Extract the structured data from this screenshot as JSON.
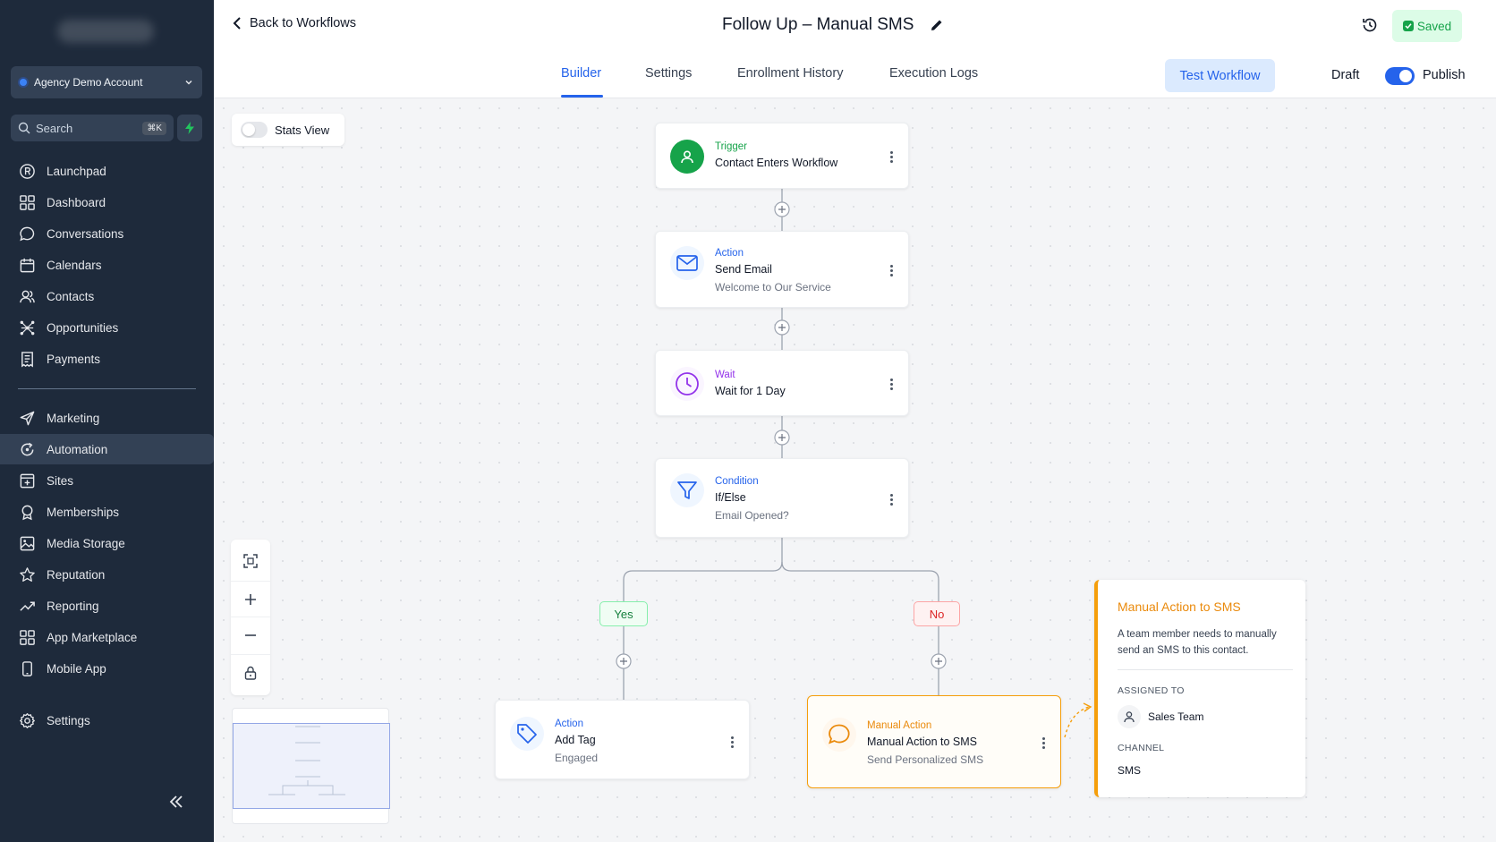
{
  "sidebar": {
    "account": "Agency Demo Account",
    "search_placeholder": "Search",
    "search_shortcut": "⌘K",
    "items": [
      {
        "label": "Launchpad",
        "icon": "launchpad-icon"
      },
      {
        "label": "Dashboard",
        "icon": "dashboard-icon"
      },
      {
        "label": "Conversations",
        "icon": "chat-icon"
      },
      {
        "label": "Calendars",
        "icon": "calendar-icon"
      },
      {
        "label": "Contacts",
        "icon": "contacts-icon"
      },
      {
        "label": "Opportunities",
        "icon": "opportunities-icon"
      },
      {
        "label": "Payments",
        "icon": "payments-icon"
      },
      {
        "label": "Marketing",
        "icon": "send-icon"
      },
      {
        "label": "Automation",
        "icon": "automation-icon"
      },
      {
        "label": "Sites",
        "icon": "sites-icon"
      },
      {
        "label": "Memberships",
        "icon": "memberships-icon"
      },
      {
        "label": "Media Storage",
        "icon": "image-icon"
      },
      {
        "label": "Reputation",
        "icon": "star-icon"
      },
      {
        "label": "Reporting",
        "icon": "trend-icon"
      },
      {
        "label": "App Marketplace",
        "icon": "grid-icon"
      },
      {
        "label": "Mobile App",
        "icon": "phone-icon"
      },
      {
        "label": "Settings",
        "icon": "gear-icon"
      }
    ],
    "active_item": "Automation"
  },
  "header": {
    "back_label": "Back to Workflows",
    "title": "Follow Up – Manual SMS",
    "saved_label": "Saved",
    "tabs": [
      {
        "label": "Builder"
      },
      {
        "label": "Settings"
      },
      {
        "label": "Enrollment History"
      },
      {
        "label": "Execution Logs"
      }
    ],
    "active_tab": "Builder",
    "test_button": "Test Workflow",
    "draft_label": "Draft",
    "publish_label": "Publish",
    "publish_on": true
  },
  "canvas": {
    "stats_view_label": "Stats View",
    "stats_view_on": false,
    "nodes": {
      "trigger": {
        "type": "Trigger",
        "name": "Contact Enters Workflow"
      },
      "email": {
        "type": "Action",
        "name": "Send Email",
        "sub": "Welcome to Our Service"
      },
      "wait": {
        "type": "Wait",
        "name": "Wait for 1 Day"
      },
      "condition": {
        "type": "Condition",
        "name": "If/Else",
        "sub": "Email Opened?"
      },
      "tag": {
        "type": "Action",
        "name": "Add Tag",
        "sub": "Engaged"
      },
      "manual": {
        "type": "Manual Action",
        "name": "Manual Action to SMS",
        "sub": "Send Personalized SMS"
      }
    },
    "branches": {
      "yes": "Yes",
      "no": "No"
    },
    "detail_panel": {
      "title": "Manual Action to SMS",
      "description": "A team member needs to manually send an SMS to this contact.",
      "assigned_label": "ASSIGNED TO",
      "assigned_value": "Sales Team",
      "channel_label": "CHANNEL",
      "channel_value": "SMS"
    }
  },
  "colors": {
    "accent": "#2563eb",
    "trigger": "#16a34a",
    "wait": "#9333ea",
    "manual": "#ea8a0c",
    "sidebar_bg": "#1e2a3b"
  }
}
